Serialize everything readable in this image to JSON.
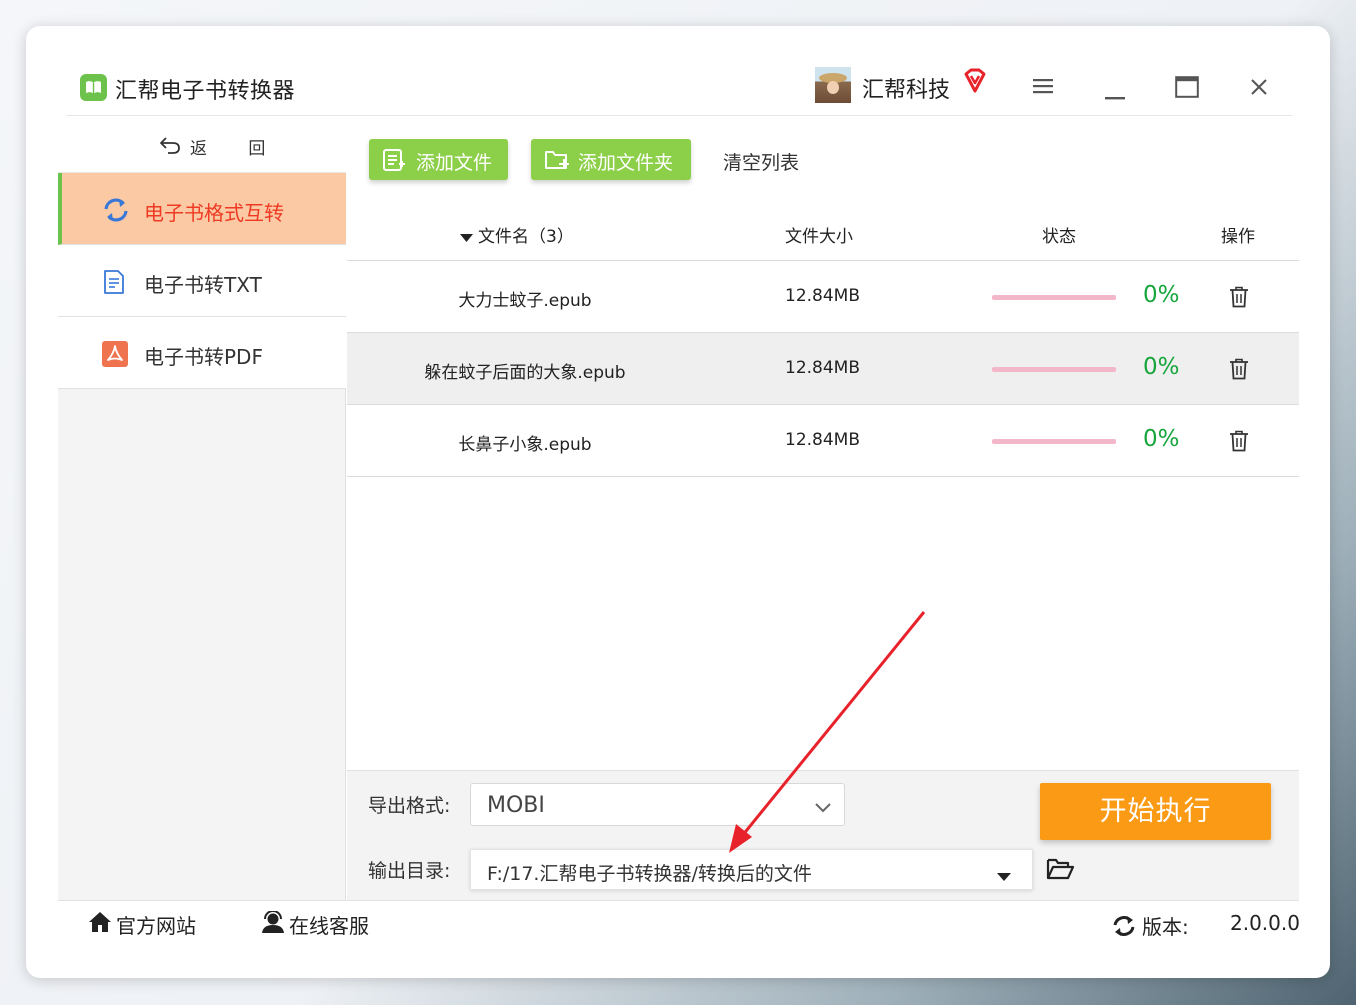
{
  "app": {
    "title": "汇帮电子书转换器",
    "logo_icon": "book-icon",
    "brand_color": "#6cc24a"
  },
  "user": {
    "name": "汇帮科技",
    "vip_icon": "vip-diamond-icon",
    "vip_color": "#e8222b"
  },
  "window_controls": [
    "menu-icon",
    "minimize-icon",
    "maximize-icon",
    "close-icon"
  ],
  "sidebar": {
    "back_label": "返 回",
    "items": [
      {
        "label": "电子书格式互转",
        "icon": "refresh-icon",
        "active": true
      },
      {
        "label": "电子书转TXT",
        "icon": "document-icon",
        "active": false
      },
      {
        "label": "电子书转PDF",
        "icon": "pdf-icon",
        "active": false
      }
    ]
  },
  "toolbar": {
    "add_file": "添加文件",
    "add_folder": "添加文件夹",
    "clear_list": "清空列表",
    "button_color": "#8ccf48"
  },
  "table": {
    "headers": {
      "name": "文件名（3）",
      "size": "文件大小",
      "status": "状态",
      "action": "操作"
    },
    "rows": [
      {
        "name": "大力士蚊子.epub",
        "size": "12.84MB",
        "progress": 0,
        "progress_label": "0%"
      },
      {
        "name": "躲在蚊子后面的大象.epub",
        "size": "12.84MB",
        "progress": 0,
        "progress_label": "0%"
      },
      {
        "name": "长鼻子小象.epub",
        "size": "12.84MB",
        "progress": 0,
        "progress_label": "0%"
      }
    ]
  },
  "settings": {
    "format_label": "导出格式:",
    "format_value": "MOBI",
    "dir_label": "输出目录:",
    "dir_value": "F:/17.汇帮电子书转换器/转换后的文件",
    "start_button": "开始执行",
    "start_color": "#fb9a14"
  },
  "footer": {
    "website": "官方网站",
    "support": "在线客服",
    "version_label": "版本:",
    "version_value": "2.0.0.0"
  },
  "colors": {
    "active_item_bg": "#fbc9a4",
    "active_item_text": "#ee3a23",
    "progress_track": "#f2b8c9",
    "percent_text": "#17a53c",
    "annotation_arrow": "#e8222b"
  }
}
